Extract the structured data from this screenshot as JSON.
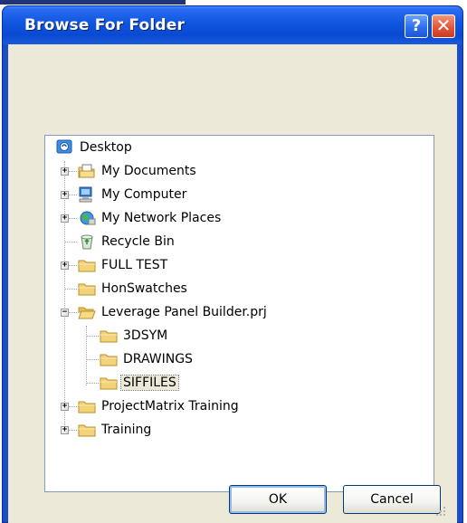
{
  "window": {
    "title": "Browse For Folder",
    "help_label": "?",
    "close_label": "✕"
  },
  "tree": {
    "root": {
      "label": "Desktop",
      "icon": "desktop-icon"
    },
    "items": [
      {
        "label": "My Documents",
        "icon": "my-documents-icon",
        "expander": "+"
      },
      {
        "label": "My Computer",
        "icon": "my-computer-icon",
        "expander": "+"
      },
      {
        "label": "My Network Places",
        "icon": "network-places-icon",
        "expander": "+"
      },
      {
        "label": "Recycle Bin",
        "icon": "recycle-bin-icon",
        "expander": ""
      },
      {
        "label": "FULL TEST",
        "icon": "folder-icon",
        "expander": "+"
      },
      {
        "label": "HonSwatches",
        "icon": "folder-icon",
        "expander": ""
      },
      {
        "label": "Leverage Panel Builder.prj",
        "icon": "folder-open-icon",
        "expander": "−"
      },
      {
        "label": "3DSYM",
        "icon": "folder-icon",
        "expander": ""
      },
      {
        "label": "DRAWINGS",
        "icon": "folder-icon",
        "expander": ""
      },
      {
        "label": "SIFFILES",
        "icon": "folder-icon",
        "expander": "",
        "selected": true
      },
      {
        "label": "ProjectMatrix Training",
        "icon": "folder-icon",
        "expander": "+"
      },
      {
        "label": "Training",
        "icon": "folder-icon",
        "expander": "+"
      }
    ]
  },
  "buttons": {
    "ok_label": "OK",
    "cancel_label": "Cancel"
  },
  "colors": {
    "titlebar": "#0a4ad3",
    "dialog_face": "#ece9d8",
    "folder": "#f3d37a",
    "selection": "#ece9d8"
  }
}
